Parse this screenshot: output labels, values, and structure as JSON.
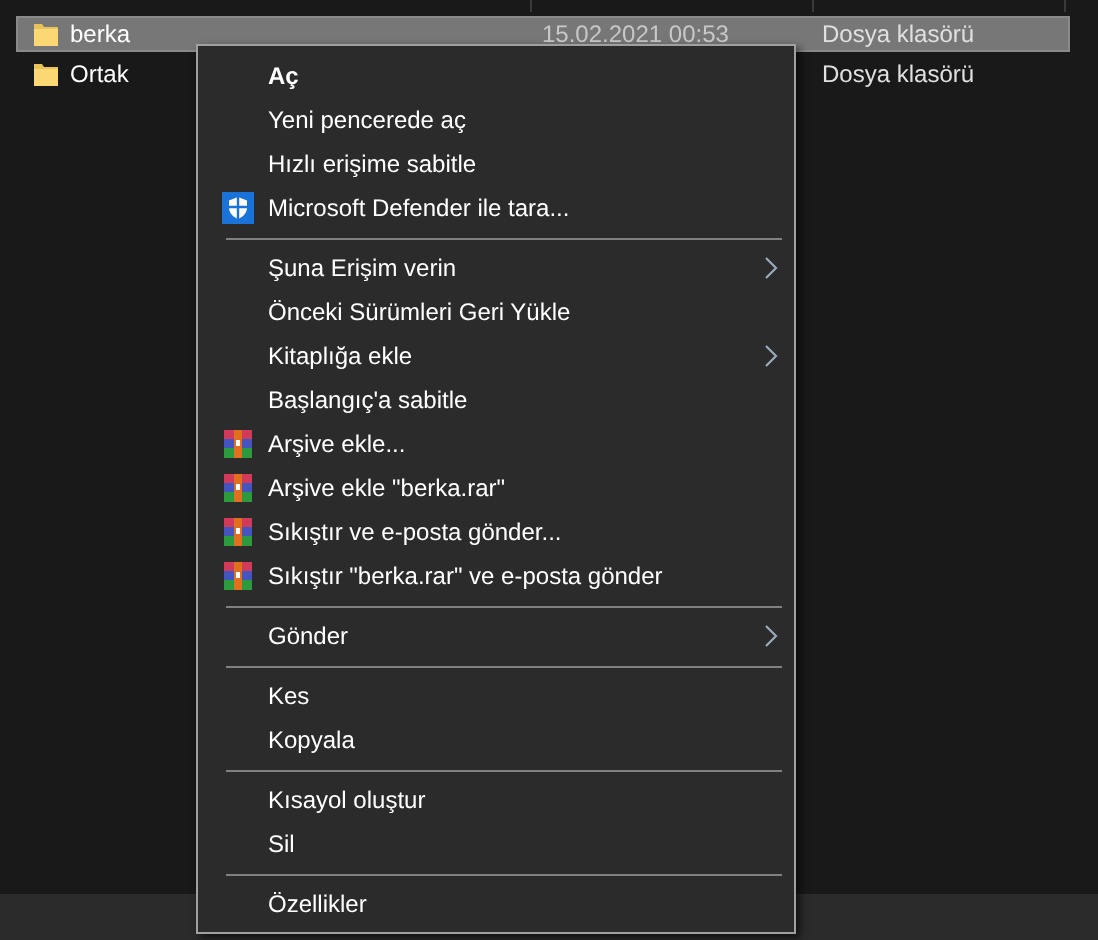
{
  "files": [
    {
      "name": "berka",
      "modified": "15.02.2021 00:53",
      "type": "Dosya klasörü",
      "selected": true
    },
    {
      "name": "Ortak",
      "type": "Dosya klasörü",
      "selected": false
    }
  ],
  "context_menu": [
    {
      "kind": "item",
      "label": "Aç",
      "default": true
    },
    {
      "kind": "item",
      "label": "Yeni pencerede aç"
    },
    {
      "kind": "item",
      "label": "Hızlı erişime sabitle"
    },
    {
      "kind": "shield_item",
      "label": "Microsoft Defender ile tara..."
    },
    {
      "kind": "separator"
    },
    {
      "kind": "item",
      "label": "Şuna Erişim verin",
      "submenu": true
    },
    {
      "kind": "item",
      "label": "Önceki Sürümleri Geri Yükle"
    },
    {
      "kind": "item",
      "label": "Kitaplığa ekle",
      "submenu": true
    },
    {
      "kind": "item",
      "label": "Başlangıç'a sabitle"
    },
    {
      "kind": "archive_item",
      "label": "Arşive ekle..."
    },
    {
      "kind": "archive_item",
      "label": "Arşive ekle \"berka.rar\""
    },
    {
      "kind": "archive_item",
      "label": "Sıkıştır ve e-posta gönder..."
    },
    {
      "kind": "archive_item",
      "label": "Sıkıştır \"berka.rar\" ve e-posta gönder"
    },
    {
      "kind": "separator"
    },
    {
      "kind": "item",
      "label": "Gönder",
      "submenu": true
    },
    {
      "kind": "separator"
    },
    {
      "kind": "item",
      "label": "Kes"
    },
    {
      "kind": "item",
      "label": "Kopyala"
    },
    {
      "kind": "separator"
    },
    {
      "kind": "item",
      "label": "Kısayol oluştur"
    },
    {
      "kind": "item",
      "label": "Sil"
    },
    {
      "kind": "separator"
    },
    {
      "kind": "item",
      "label": "Özellikler"
    }
  ]
}
